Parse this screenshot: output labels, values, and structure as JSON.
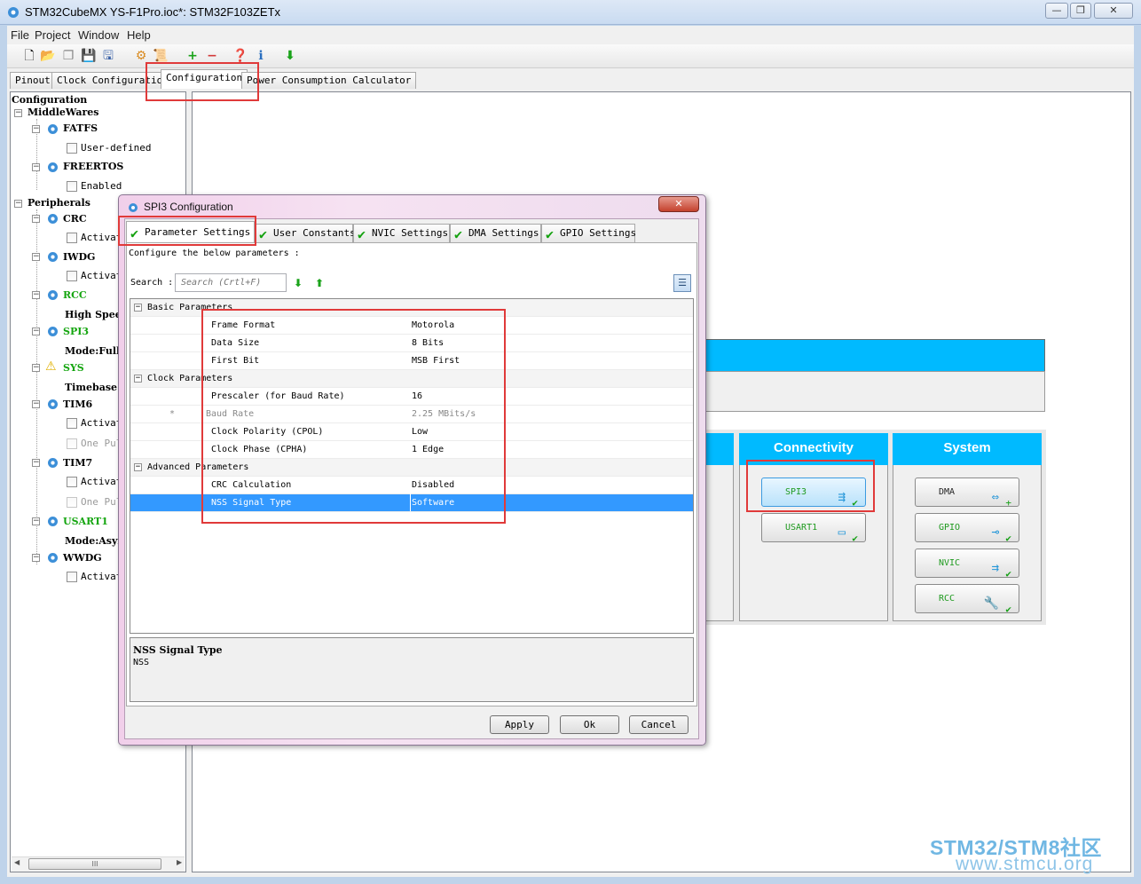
{
  "window": {
    "title": "STM32CubeMX YS-F1Pro.ioc*: STM32F103ZETx",
    "controls": [
      "—",
      "❐",
      "✕"
    ]
  },
  "menu": [
    "File",
    "Project",
    "Window",
    "Help"
  ],
  "main_tabs": [
    {
      "label": "Pinout"
    },
    {
      "label": "Clock Configuration"
    },
    {
      "label": "Configuration",
      "active": true
    },
    {
      "label": "Power Consumption Calculator"
    }
  ],
  "tree": {
    "root": "Configuration",
    "middlewares": {
      "label": "MiddleWares",
      "fatfs": {
        "label": "FATFS",
        "option": "User-defined"
      },
      "freertos": {
        "label": "FREERTOS",
        "option": "Enabled"
      }
    },
    "peripherals": {
      "label": "Peripherals",
      "crc": {
        "label": "CRC",
        "option": "Activat"
      },
      "iwdg": {
        "label": "IWDG",
        "option": "Activat"
      },
      "rcc": {
        "label": "RCC",
        "option": "High Spee"
      },
      "spi3": {
        "label": "SPI3",
        "option": "Mode:Full-"
      },
      "sys": {
        "label": "SYS",
        "option": "Timebase"
      },
      "tim6": {
        "label": "TIM6",
        "option1": "Activat",
        "option2": "One Pul"
      },
      "tim7": {
        "label": "TIM7",
        "option1": "Activat",
        "option2": "One Pul"
      },
      "usart1": {
        "label": "USART1",
        "option": "Mode:Async"
      },
      "wwdg": {
        "label": "WWDG",
        "option": "Activat"
      }
    },
    "scroll_thumb": "III"
  },
  "categories": {
    "connectivity": {
      "title": "Connectivity",
      "buttons": [
        "SPI3",
        "USART1"
      ]
    },
    "system": {
      "title": "System",
      "buttons": [
        "DMA",
        "GPIO",
        "NVIC",
        "RCC"
      ]
    }
  },
  "dialog": {
    "title": "SPI3 Configuration",
    "close": "✕",
    "tabs": [
      "Parameter Settings",
      "User Constants",
      "NVIC Settings",
      "DMA Settings",
      "GPIO Settings"
    ],
    "prompt": "Configure the below parameters :",
    "search_label": "Search :",
    "search_placeholder": "Search (Crtl+F)",
    "groups": {
      "basic": "Basic Parameters",
      "clock": "Clock Parameters",
      "advanced": "Advanced Parameters"
    },
    "params": {
      "frame_format": {
        "key": "Frame Format",
        "value": "Motorola"
      },
      "data_size": {
        "key": "Data Size",
        "value": "8 Bits"
      },
      "first_bit": {
        "key": "First Bit",
        "value": "MSB First"
      },
      "prescaler": {
        "key": "Prescaler (for Baud Rate)",
        "value": "16"
      },
      "baud_rate": {
        "key": "Baud Rate",
        "value": "2.25 MBits/s",
        "marker": "*"
      },
      "cpol": {
        "key": "Clock Polarity (CPOL)",
        "value": "Low"
      },
      "cpha": {
        "key": "Clock Phase (CPHA)",
        "value": "1 Edge"
      },
      "crc": {
        "key": "CRC Calculation",
        "value": "Disabled"
      },
      "nss": {
        "key": "NSS Signal Type",
        "value": "Software"
      }
    },
    "description": {
      "title": "NSS Signal Type",
      "body": "NSS"
    },
    "buttons": {
      "apply": "Apply",
      "ok": "Ok",
      "cancel": "Cancel"
    }
  },
  "watermark": {
    "line1": "STM32/STM8社区",
    "line2": "www.stmcu.org"
  },
  "colors": {
    "accent": "#00baff",
    "highlight": "#e03a3a",
    "selection": "#3399ff",
    "ok_green": "#14a50f"
  }
}
